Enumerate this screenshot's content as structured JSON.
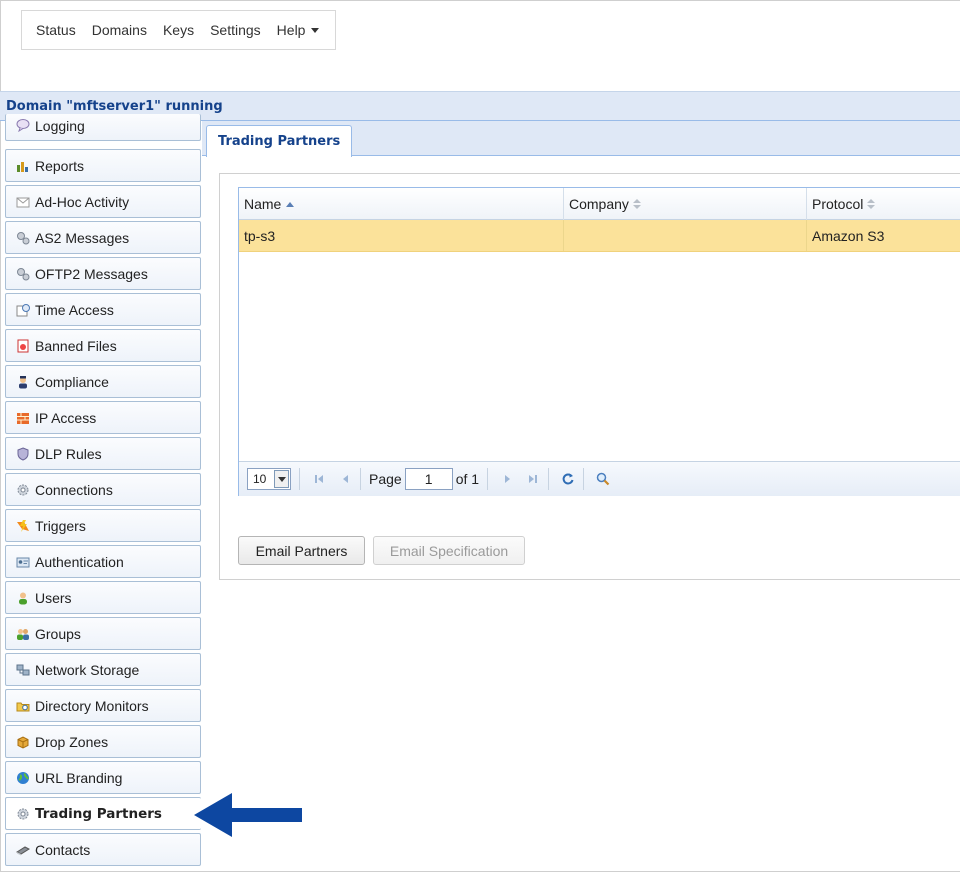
{
  "topnav": {
    "items": [
      "Status",
      "Domains",
      "Keys",
      "Settings",
      "Help"
    ]
  },
  "domain_bar": {
    "title": "Domain \"mftserver1\" running"
  },
  "sidebar": {
    "items": [
      {
        "label": "Logging",
        "icon": "speech-bubble-icon"
      },
      {
        "label": "Reports",
        "icon": "bar-chart-icon"
      },
      {
        "label": "Ad-Hoc Activity",
        "icon": "envelope-icon"
      },
      {
        "label": "AS2 Messages",
        "icon": "gears-icon"
      },
      {
        "label": "OFTP2 Messages",
        "icon": "gears-icon"
      },
      {
        "label": "Time Access",
        "icon": "calendar-clock-icon"
      },
      {
        "label": "Banned Files",
        "icon": "banned-file-icon"
      },
      {
        "label": "Compliance",
        "icon": "officer-icon"
      },
      {
        "label": "IP Access",
        "icon": "firewall-icon"
      },
      {
        "label": "DLP Rules",
        "icon": "shield-icon"
      },
      {
        "label": "Connections",
        "icon": "gear-icon"
      },
      {
        "label": "Triggers",
        "icon": "lightning-icon"
      },
      {
        "label": "Authentication",
        "icon": "id-card-icon"
      },
      {
        "label": "Users",
        "icon": "user-icon"
      },
      {
        "label": "Groups",
        "icon": "group-icon"
      },
      {
        "label": "Network Storage",
        "icon": "network-storage-icon"
      },
      {
        "label": "Directory Monitors",
        "icon": "folder-monitor-icon"
      },
      {
        "label": "Drop Zones",
        "icon": "box-icon"
      },
      {
        "label": "URL Branding",
        "icon": "globe-icon"
      },
      {
        "label": "Trading Partners",
        "icon": "gear-icon",
        "active": true
      },
      {
        "label": "Contacts",
        "icon": "address-book-icon"
      }
    ]
  },
  "tab": {
    "label": "Trading Partners"
  },
  "grid": {
    "columns": [
      "Name",
      "Company",
      "Protocol"
    ],
    "rows": [
      {
        "name": "tp-s3",
        "company": "",
        "protocol": "Amazon S3"
      }
    ]
  },
  "pager": {
    "page_size": "10",
    "page_label": "Page",
    "current_page": "1",
    "of_label": "of 1"
  },
  "buttons": {
    "email_partners": "Email Partners",
    "email_specification": "Email Specification"
  },
  "colors": {
    "selected_row": "#fbe29a",
    "header_blue": "#15428b",
    "arrow": "#0d47a1"
  }
}
